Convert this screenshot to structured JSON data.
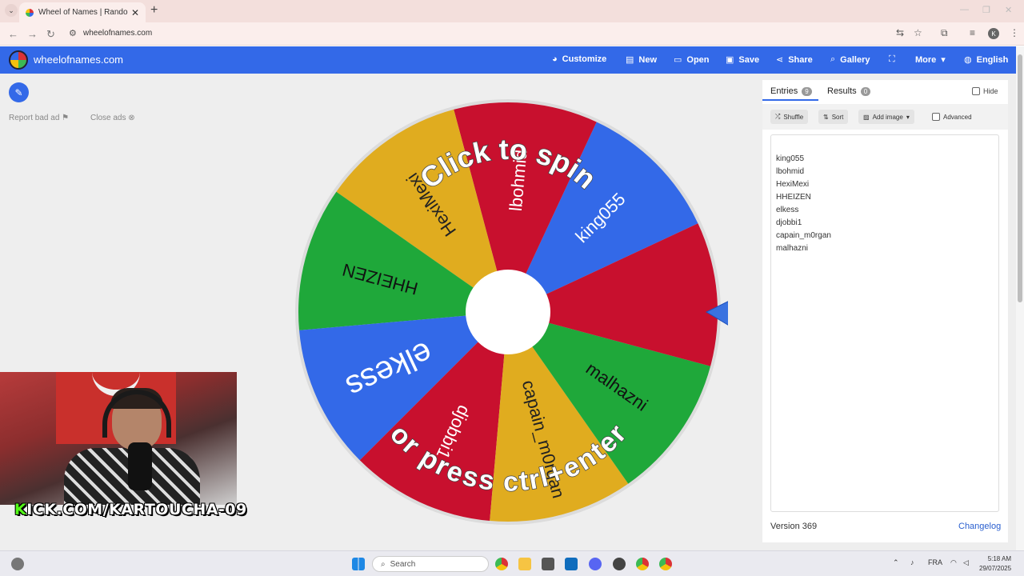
{
  "browser": {
    "tab_title": "Wheel of Names | Random nam",
    "tab_close": "✕",
    "new_tab": "+",
    "url": "wheelofnames.com"
  },
  "header": {
    "logo": "wheelofnames.com",
    "menu": [
      {
        "label": "Customize",
        "icon": "palette-icon"
      },
      {
        "label": "New",
        "icon": "file-icon"
      },
      {
        "label": "Open",
        "icon": "folder-icon"
      },
      {
        "label": "Save",
        "icon": "save-icon"
      },
      {
        "label": "Share",
        "icon": "share-icon"
      },
      {
        "label": "Gallery",
        "icon": "search-icon"
      },
      {
        "label": "",
        "icon": "fullscreen-icon"
      },
      {
        "label": "More",
        "icon": "chevron-down-icon"
      },
      {
        "label": "English",
        "icon": "globe-icon"
      }
    ]
  },
  "left": {
    "report_ad": "Report bad ad",
    "close_ads": "Close ads"
  },
  "wheel": {
    "slices": [
      {
        "label": "king055",
        "color": "#3369e8"
      },
      {
        "label": "lbohmid",
        "color": "#c8102e"
      },
      {
        "label": "HexiMexi",
        "color": "#e0ac1f"
      },
      {
        "label": "HHEIZEN",
        "color": "#1fa83a"
      },
      {
        "label": "elkess",
        "color": "#3369e8"
      },
      {
        "label": "djobbi1",
        "color": "#c8102e"
      },
      {
        "label": "capain_m0rgan",
        "color": "#e0ac1f"
      },
      {
        "label": "malhazni",
        "color": "#1fa83a"
      },
      {
        "label": "",
        "color": "#c8102e"
      }
    ],
    "top_text": "Click to spin",
    "bottom_text": "or press ctrl+enter"
  },
  "panel": {
    "entries_tab": "Entries",
    "entries_count": "9",
    "results_tab": "Results",
    "results_count": "0",
    "hide_label": "Hide",
    "shuffle": "Shuffle",
    "sort": "Sort",
    "add_image": "Add image",
    "advanced": "Advanced",
    "entries": [
      "king055",
      "lbohmid",
      "HexiMexi",
      "HHEIZEN",
      "elkess",
      "djobbi1",
      "capain_m0rgan",
      "malhazni"
    ],
    "version": "Version 369",
    "changelog": "Changelog"
  },
  "overlay": {
    "k": "K",
    "rest": "ICK.COM/KARTOUCHA-09"
  },
  "taskbar": {
    "search": "Search",
    "lang": "FRA",
    "time": "5:18 AM",
    "date": "29/07/2025"
  }
}
